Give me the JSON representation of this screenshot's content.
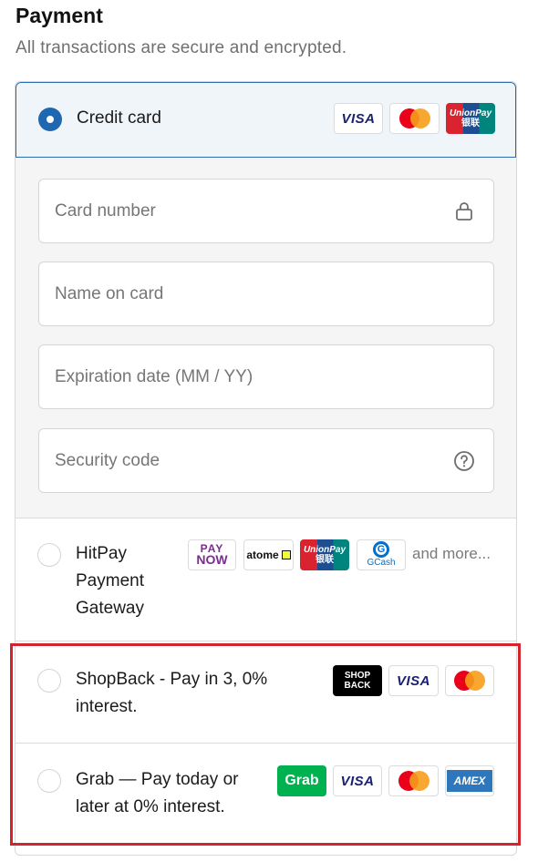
{
  "header": {
    "title": "Payment",
    "subtitle": "All transactions are secure and encrypted."
  },
  "options": [
    {
      "id": "credit-card",
      "label": "Credit card",
      "selected": true,
      "badges": [
        "VISA",
        "mastercard",
        "UnionPay"
      ]
    },
    {
      "id": "hitpay",
      "label_lines": [
        "HitPay",
        "Payment",
        "Gateway"
      ],
      "selected": false,
      "badges": [
        "PayNow",
        "atome",
        "UnionPay",
        "GCash"
      ],
      "more_text": "and more..."
    },
    {
      "id": "shopback",
      "label_lines": [
        "ShopBack - Pay in 3, 0%",
        "interest."
      ],
      "selected": false,
      "badges": [
        "ShopBack",
        "VISA",
        "mastercard"
      ]
    },
    {
      "id": "grab",
      "label_lines": [
        "Grab — Pay today or",
        "later at 0% interest."
      ],
      "selected": false,
      "badges": [
        "Grab",
        "VISA",
        "mastercard",
        "AMEX"
      ]
    }
  ],
  "card_form": {
    "card_number_placeholder": "Card number",
    "name_placeholder": "Name on card",
    "expiry_placeholder": "Expiration date (MM / YY)",
    "security_placeholder": "Security code"
  },
  "badge_text": {
    "visa": "VISA",
    "unionpay_top": "UnionPay",
    "unionpay_bottom": "银联",
    "paynow_top": "PAY",
    "paynow_bottom": "NOW",
    "atome": "atome",
    "gcash": "GCash",
    "gcash_mark": "G",
    "shopback_top": "SHOP",
    "shopback_bottom": "BACK",
    "grab": "Grab",
    "amex": "AMEX"
  },
  "icons": {
    "card_number": "lock-icon",
    "security_code": "question-circle-icon"
  },
  "colors": {
    "selected_radio": "#1f67b1",
    "selected_border": "#2d6bb0",
    "selected_bg": "#f0f5fa",
    "highlight_border": "#d3232d"
  }
}
